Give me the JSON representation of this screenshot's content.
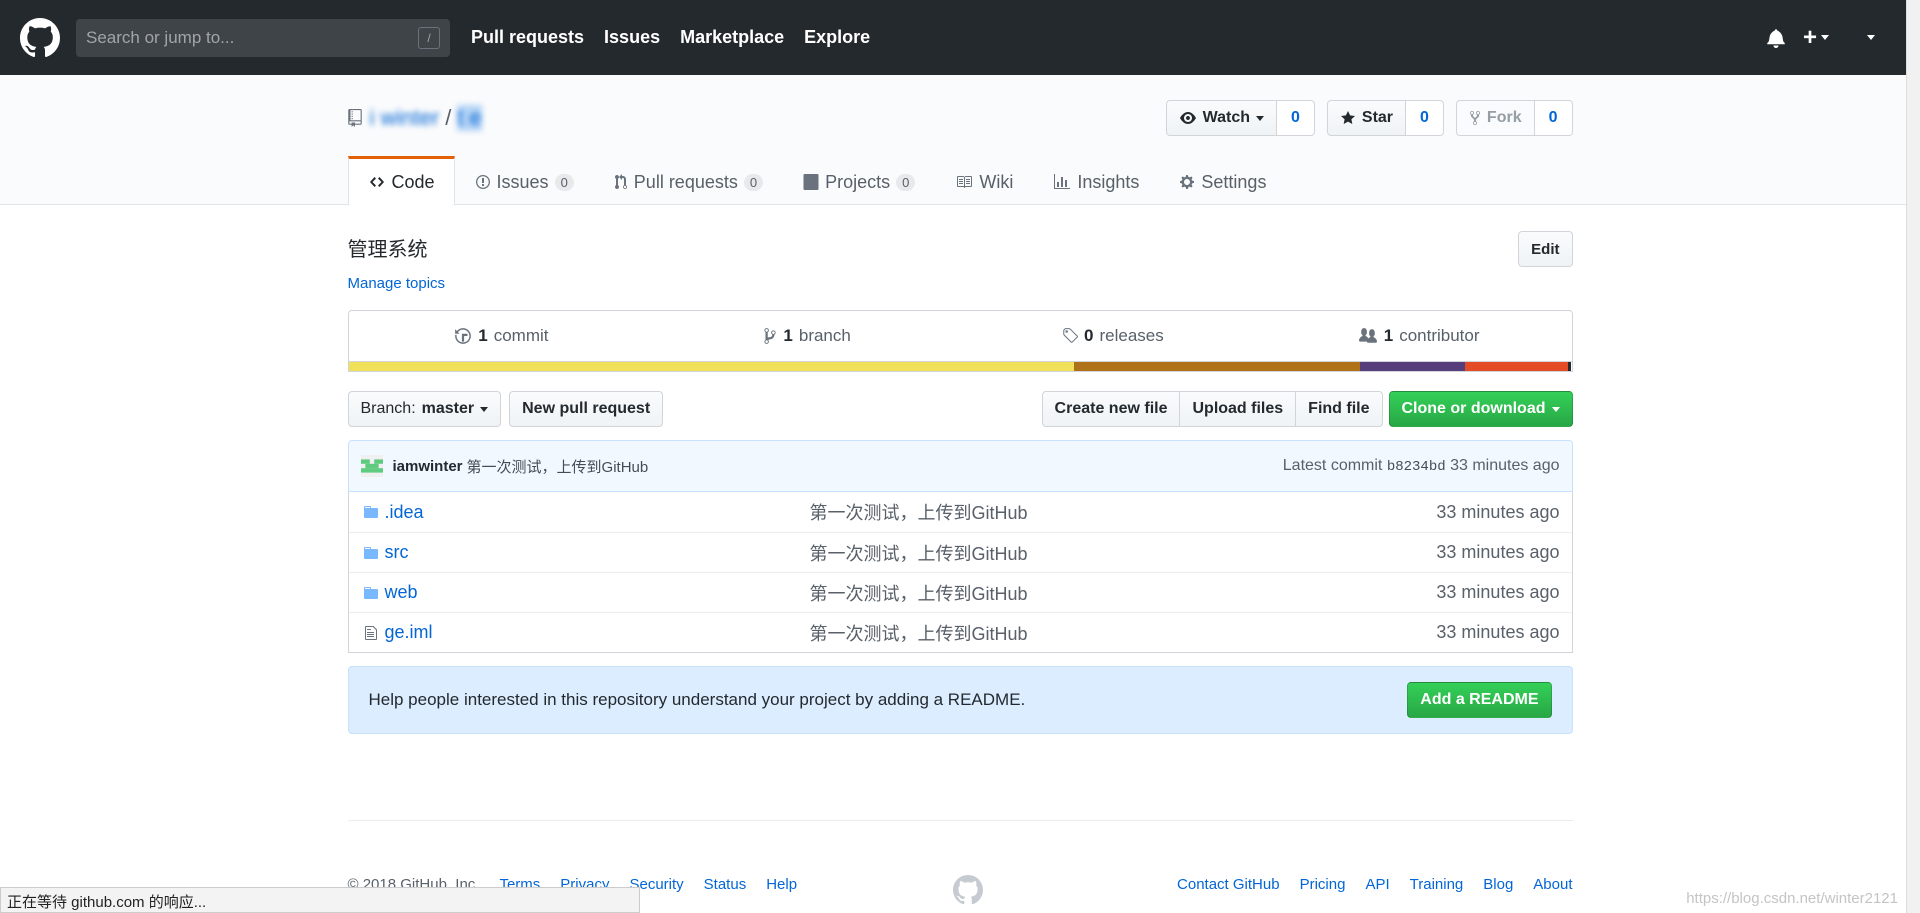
{
  "header": {
    "search_placeholder": "Search or jump to...",
    "slash_key": "/",
    "nav": [
      "Pull requests",
      "Issues",
      "Marketplace",
      "Explore"
    ],
    "plus": "+"
  },
  "repo": {
    "owner": "i   winter",
    "separator": "/",
    "name": "t             e",
    "watch_label": "Watch",
    "watch_count": "0",
    "star_label": "Star",
    "star_count": "0",
    "fork_label": "Fork",
    "fork_count": "0"
  },
  "tabs": [
    {
      "label": "Code"
    },
    {
      "label": "Issues",
      "count": "0"
    },
    {
      "label": "Pull requests",
      "count": "0"
    },
    {
      "label": "Projects",
      "count": "0"
    },
    {
      "label": "Wiki"
    },
    {
      "label": "Insights"
    },
    {
      "label": "Settings"
    }
  ],
  "description": {
    "blurred": "            ",
    "text": "管理系统",
    "manage_topics": "Manage topics",
    "edit": "Edit"
  },
  "summary": {
    "commits_num": "1",
    "commits_label": "commit",
    "branches_num": "1",
    "branches_label": "branch",
    "releases_num": "0",
    "releases_label": "releases",
    "contributors_num": "1",
    "contributors_label": "contributor"
  },
  "languages": [
    {
      "color": "#f1e05a",
      "share": 59.3
    },
    {
      "color": "#b07219",
      "share": 23.4
    },
    {
      "color": "#563d7c",
      "share": 8.6
    },
    {
      "color": "#e34c26",
      "share": 8.4
    },
    {
      "color": "#24292e",
      "share": 0.3
    }
  ],
  "filenav": {
    "branch_prefix": "Branch:",
    "branch": "master",
    "new_pr": "New pull request",
    "create_file": "Create new file",
    "upload": "Upload files",
    "find": "Find file",
    "clone": "Clone or download"
  },
  "commit": {
    "author": "iamwinter",
    "message": "第一次测试，上传到GitHub",
    "latest_label": "Latest commit",
    "sha": "b8234bd",
    "age": "33 minutes ago"
  },
  "files": [
    {
      "type": "dir",
      "name": ".idea",
      "msg": "第一次测试，上传到GitHub",
      "age": "33 minutes ago"
    },
    {
      "type": "dir",
      "name": "src",
      "msg": "第一次测试，上传到GitHub",
      "age": "33 minutes ago"
    },
    {
      "type": "dir",
      "name": "web",
      "msg": "第一次测试，上传到GitHub",
      "age": "33 minutes ago"
    },
    {
      "type": "file",
      "name": "ge.iml",
      "msg": "第一次测试，上传到GitHub",
      "age": "33 minutes ago"
    }
  ],
  "readme": {
    "text": "Help people interested in this repository understand your project by adding a README.",
    "button": "Add a README"
  },
  "footer": {
    "copyright": "© 2018 GitHub, Inc.",
    "left_links": [
      "Terms",
      "Privacy",
      "Security",
      "Status",
      "Help"
    ],
    "right_links": [
      "Contact GitHub",
      "Pricing",
      "API",
      "Training",
      "Blog",
      "About"
    ]
  },
  "browser": {
    "status": "正在等待 github.com 的响应...",
    "watermark": "https://blog.csdn.net/winter2121"
  }
}
